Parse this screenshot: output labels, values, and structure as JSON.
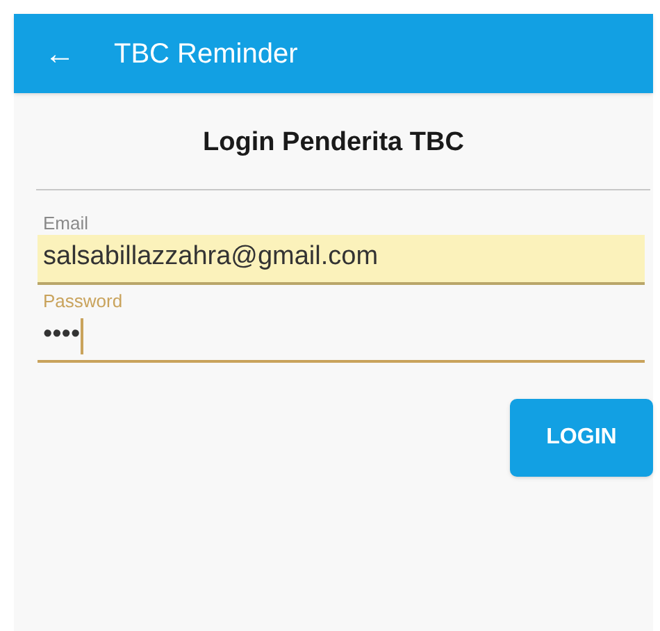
{
  "app_bar": {
    "back_icon": "←",
    "title": "TBC Reminder"
  },
  "heading": "Login Penderita TBC",
  "fields": [
    {
      "label": "Email",
      "value": "salsabillazzahra@gmail.com",
      "autofilled": true,
      "focused": false
    },
    {
      "label": "Password",
      "value": "••••",
      "autofilled": false,
      "focused": true
    }
  ],
  "button": "LOGIN"
}
